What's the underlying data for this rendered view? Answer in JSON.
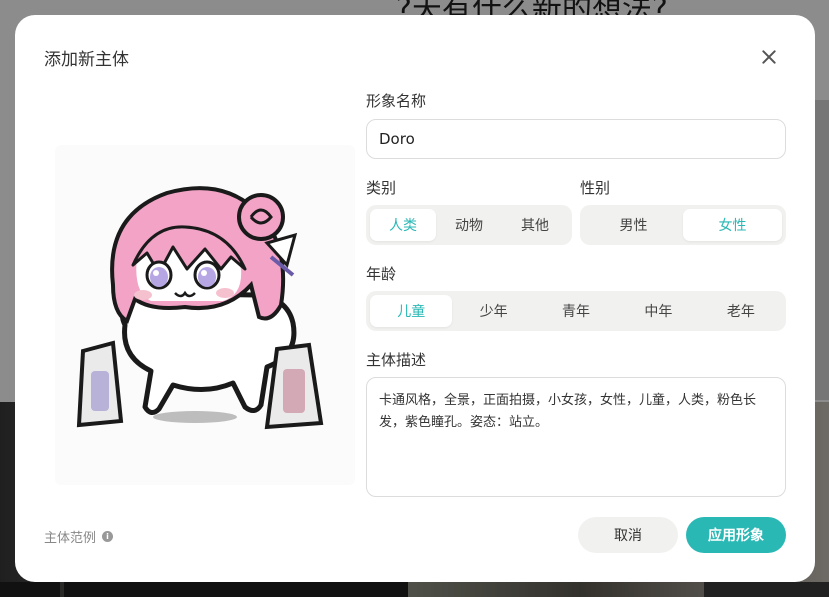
{
  "background": {
    "heading": "?天有什么新的想法?"
  },
  "modal": {
    "title": "添加新主体",
    "name_label": "形象名称",
    "name_value": "Doro",
    "category_label": "类别",
    "category_options": [
      "人类",
      "动物",
      "其他"
    ],
    "category_selected": "人类",
    "gender_label": "性别",
    "gender_options": [
      "男性",
      "女性"
    ],
    "gender_selected": "女性",
    "age_label": "年龄",
    "age_options": [
      "儿童",
      "少年",
      "青年",
      "中年",
      "老年"
    ],
    "age_selected": "儿童",
    "desc_label": "主体描述",
    "desc_value": "卡通风格，全景，正面拍摄，小女孩，女性，儿童，人类，粉色长发，紫色瞳孔。姿态：站立。",
    "example_label": "主体范例",
    "cancel_label": "取消",
    "apply_label": "应用形象"
  },
  "colors": {
    "accent": "#2ab8b5",
    "segment_bg": "#f1f1ef"
  },
  "icons": {
    "close": "close-icon",
    "info": "info-icon"
  }
}
